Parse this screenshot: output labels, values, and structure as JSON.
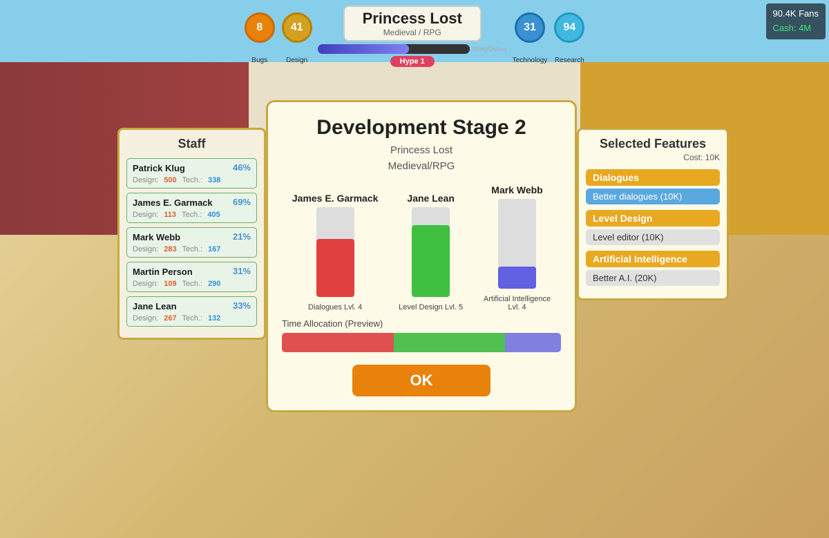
{
  "game": {
    "title": "Princess Lost",
    "subtitle": "Medieval / RPG"
  },
  "hud": {
    "bugs_count": "8",
    "bugs_label": "Bugs",
    "design_count": "41",
    "design_label": "Design",
    "story_label": "Story/Debug",
    "hype_label": "Hype 1",
    "tech_count": "31",
    "tech_label": "Technology",
    "research_count": "94",
    "research_label": "Research"
  },
  "top_right": {
    "fans": "90.4K Fans",
    "cash": "Cash: 4M"
  },
  "staff_panel": {
    "title": "Staff",
    "members": [
      {
        "name": "Patrick Klug",
        "percent": "46%",
        "design_label": "Design:",
        "design_val": "500",
        "tech_label": "Tech.:",
        "tech_val": "338"
      },
      {
        "name": "James E. Garmack",
        "percent": "69%",
        "design_label": "Design:",
        "design_val": "113",
        "tech_label": "Tech.:",
        "tech_val": "405"
      },
      {
        "name": "Mark Webb",
        "percent": "21%",
        "design_label": "Design:",
        "design_val": "283",
        "tech_label": "Tech.:",
        "tech_val": "167"
      },
      {
        "name": "Martin Person",
        "percent": "31%",
        "design_label": "Design:",
        "design_val": "109",
        "tech_label": "Tech.:",
        "tech_val": "290"
      },
      {
        "name": "Jane Lean",
        "percent": "33%",
        "design_label": "Design:",
        "design_val": "267",
        "tech_label": "Tech.:",
        "tech_val": "132"
      }
    ]
  },
  "modal": {
    "title": "Development Stage 2",
    "game_name": "Princess Lost",
    "genre": "Medieval/RPG",
    "staff_bars": [
      {
        "name": "James E. Garmack",
        "fill_color": "bar-fill-red",
        "height_pct": 65,
        "label": "Dialogues Lvl. 4"
      },
      {
        "name": "Jane Lean",
        "fill_color": "bar-fill-green",
        "height_pct": 80,
        "label": "Level Design Lvl. 5"
      },
      {
        "name": "Mark Webb",
        "fill_color": "bar-fill-blue",
        "height_pct": 25,
        "label": "Artificial Intelligence\nLvl. 4"
      }
    ],
    "time_allocation_label": "Time Allocation (Preview)",
    "ok_label": "OK"
  },
  "features": {
    "title": "Selected Features",
    "cost": "Cost: 10K",
    "categories": [
      {
        "name": "Dialogues",
        "item": "Better dialogues (10K)",
        "item_highlighted": true
      },
      {
        "name": "Level Design",
        "item": "Level editor (10K)",
        "item_highlighted": false
      },
      {
        "name": "Artificial Intelligence",
        "item": "Better A.I. (20K)",
        "item_highlighted": false
      }
    ]
  }
}
